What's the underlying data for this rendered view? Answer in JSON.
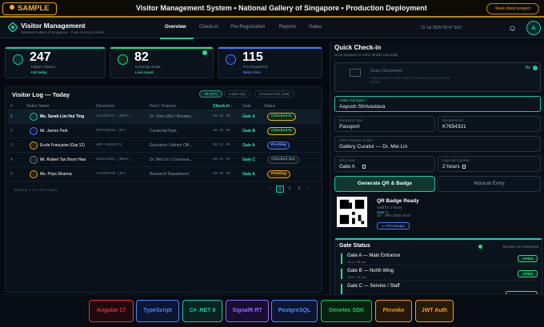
{
  "banner": {
    "sample": "SAMPLE",
    "title": "Visitor Management System  •  National Gallery of Singapore  •  Production Deployment",
    "real_client": "Real client project"
  },
  "header": {
    "brand": "Visitor Management",
    "brand_sub": "National Gallery of Singapore  ·  Gate Access Control",
    "tabs": [
      "Overview",
      "Check-in",
      "Pre-Registration",
      "Reports",
      "Gates"
    ],
    "datetime": "12 Jul 2026  09:47 SGT",
    "avatar": "A"
  },
  "stats": [
    {
      "value": "247",
      "label": "Today's Visitors",
      "sub": "+18 today",
      "color": "#22c6a8"
    },
    {
      "value": "82",
      "label": "Currently Inside",
      "sub": "Live count",
      "color": "#22e08a"
    },
    {
      "value": "115",
      "label": "Pre-Registered",
      "sub": "Next 4 hrs",
      "color": "#4a78ff"
    }
  ],
  "log": {
    "title": "Visitor Log — Today",
    "filters": [
      "All (247)",
      "Inside (82)",
      "Checked Out (165)"
    ],
    "columns": [
      "#",
      "Visitor Name",
      "Document",
      "Host / Purpose",
      "Check-in ↓",
      "Gate",
      "Status"
    ],
    "rows": [
      {
        "n": "1",
        "name": "Ms. Sarah Lim Hui Ting",
        "doc": "S1234567A (NRIC)",
        "host": "Dr. Chen Wei / Researc...",
        "time": "09:45 AM",
        "gate": "Gate A",
        "status": "Checked In"
      },
      {
        "n": "2",
        "name": "Mr. James Park",
        "doc": "P56789010 (EP)",
        "host": "Curatorial Dept.",
        "time": "09:38 AM",
        "gate": "Gate B",
        "status": "Checked In"
      },
      {
        "n": "3",
        "name": "École Française (Grp 12)",
        "doc": "GRP-20260712",
        "host": "Education / Admin Offi...",
        "time": "09:22 AM",
        "gate": "Gate A",
        "status": "Pre-Reg"
      },
      {
        "n": "4",
        "name": "Mr. Robert Tan Boon Hwa",
        "doc": "S8812345C (NRIC)",
        "host": "Dr. Mei Lin / Conserva...",
        "time": "09:15 AM",
        "gate": "Gate C",
        "status": "Checked Out"
      },
      {
        "n": "5",
        "name": "Ms. Priya Sharma",
        "doc": "F23456789 (EP)",
        "host": "Research Department",
        "time": "08:58 AM",
        "gate": "Gate A",
        "status": "Pending"
      }
    ],
    "showing": "Showing 1–5 of 247 visitors",
    "pages": [
      "‹",
      "1",
      "2",
      "3",
      "›"
    ]
  },
  "checkin": {
    "title": "Quick Check-in",
    "sub": "Scan passport or enter details manually",
    "scan_title": "Scan Document",
    "scan_hint": "Hold passport / visa / NRIC to scanner or use camera below",
    "re": "Re",
    "name_label": "Visitor Full Name *",
    "name_value": "Aayush Shrivastava",
    "doctype_label": "Document Type",
    "doctype_value": "Passport",
    "docno_label": "Document No.",
    "docno_value": "K7654321",
    "host_label": "Host / Purpose of Visit *",
    "host_value": "Gallery Curator — Dr. Mei Lin",
    "gate_label": "Entry Gate",
    "gate_value": "Gate A",
    "dur_label": "Expected Duration",
    "dur_value": "2 hours",
    "gen_btn": "Generate QR & Badge",
    "manual_btn": "Manual Entry",
    "qr_title": "QR Badge Ready",
    "qr_valid": "Valid for: 2 hours",
    "qr_gate": "Gate: A",
    "qr_id": "ID: VMS-2026-0247",
    "print": "Print Badge"
  },
  "gates": {
    "title": "Gate Status",
    "connected": "Genetec SC Connected",
    "items": [
      {
        "name": "Gate A — Main Entrance",
        "meta": "42 in / 38 out",
        "status": "OPEN"
      },
      {
        "name": "Gate B — North Wing",
        "meta": "18 in / 15 out",
        "status": "OPEN"
      },
      {
        "name": "Gate C — Service / Staff",
        "meta": "",
        "status": ""
      }
    ]
  },
  "tech": [
    {
      "label": "Angular 17",
      "color": "#e0303c"
    },
    {
      "label": "TypeScript",
      "color": "#4a86ff"
    },
    {
      "label": "C# .NET 8",
      "color": "#22c6a8"
    },
    {
      "label": "SignalR RT",
      "color": "#9a62ff"
    },
    {
      "label": "PostgreSQL",
      "color": "#4a8cff"
    },
    {
      "label": "Genetec SDK",
      "color": "#22c66a"
    },
    {
      "label": "PInvoke",
      "color": "#f09a1a"
    },
    {
      "label": "JWT Auth",
      "color": "#f0a020"
    }
  ]
}
